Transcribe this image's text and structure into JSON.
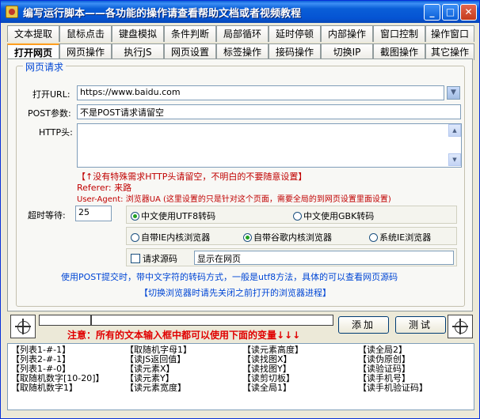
{
  "window": {
    "title": "编写运行脚本——各功能的操作请查看帮助文档或者视频教程"
  },
  "tabs_row1": [
    "文本提取",
    "鼠标点击",
    "键盘模拟",
    "条件判断",
    "局部循环",
    "延时停顿",
    "内部操作",
    "窗口控制",
    "操作窗口"
  ],
  "tabs_row2": [
    "打开网页",
    "网页操作",
    "执行JS",
    "网页设置",
    "标签操作",
    "接码操作",
    "切换IP",
    "截图操作",
    "其它操作"
  ],
  "group": {
    "title": "网页请求"
  },
  "form": {
    "url_label": "打开URL:",
    "url_value": "https://www.baidu.com",
    "post_label": "POST参数:",
    "post_value": "不是POST请求请留空",
    "http_label": "HTTP头:",
    "http_value": "",
    "timeout_label": "超时等待:",
    "timeout_value": "25"
  },
  "hints": {
    "line1": "【↑没有特殊需求HTTP头请留空，不明白的不要随意设置】",
    "line2": "Referer: 来路",
    "line3": "User-Agent: 浏览器UA (这里设置的只是针对这个页面，需要全局的到网页设置里面设置)"
  },
  "encoding": {
    "utf8_label": "中文使用UTF8转码",
    "utf8_selected": true,
    "gbk_label": "中文使用GBK转码"
  },
  "browser": {
    "ie_label": "自带IE内核浏览器",
    "chrome_label": "自带谷歌内核浏览器",
    "chrome_selected": true,
    "system_label": "系统IE浏览器"
  },
  "source": {
    "checkbox_label": "请求源码",
    "display_value": "显示在网页"
  },
  "info": {
    "line1": "使用POST提交时，带中文字符的转码方式，一般是utf8方法，具体的可以查看网页源码",
    "line2": "【切换浏览器时请先关闭之前打开的浏览器进程】"
  },
  "bottom": {
    "warning": "注意：所有的文本输入框中都可以使用下面的变量↓↓↓",
    "add_label": "添加",
    "test_label": "测试"
  },
  "variables": [
    [
      "【列表1-#-1】",
      "【取随机字母1】",
      "【读元素高度】",
      "【读全局2】"
    ],
    [
      "【列表2-#-1】",
      "【读JS返回值】",
      "【读找图X】",
      "【读伪原创】"
    ],
    [
      "【列表1-#-0】",
      "【读元素X】",
      "【读找图Y】",
      "【读验证码】"
    ],
    [
      "【取随机数字[10-20]】",
      "【读元素Y】",
      "【读剪切板】",
      "【读手机号】"
    ],
    [
      "【取随机数字1】",
      "【读元素宽度】",
      "【读全局1】",
      "【读手机验证码】"
    ]
  ]
}
